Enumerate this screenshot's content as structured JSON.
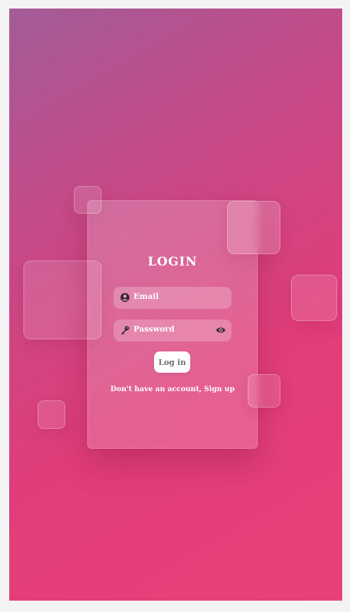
{
  "login": {
    "title": "LOGIN",
    "email_placeholder": "Email",
    "password_placeholder": "Password",
    "submit_label": "Log in",
    "signup_prompt": "Don't have an account,",
    "signup_link": "Sign up"
  },
  "icons": {
    "email": "user-circle-icon",
    "password": "key-icon",
    "show_password": "eye-icon"
  },
  "colors": {
    "background_start": "#a35c97",
    "background_end": "#e8417a",
    "card_text": "#ffffff",
    "button_bg": "#ffffff",
    "button_text": "#6e6e6e"
  }
}
